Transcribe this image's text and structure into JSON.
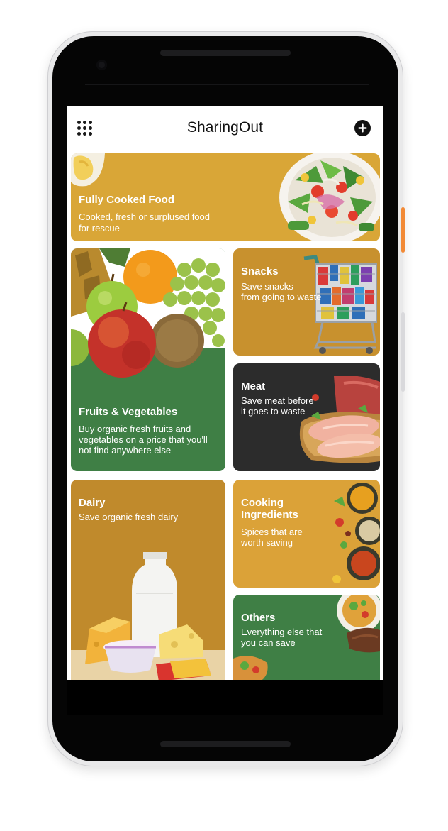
{
  "app": {
    "title": "SharingOut",
    "menu_icon": "grid-menu-icon",
    "add_icon": "plus-circle-icon"
  },
  "colors": {
    "mustard": "#d9a637",
    "dark_mustard": "#c8912e",
    "green": "#3f7f45",
    "charcoal": "#2c2c2c",
    "phone_accent": "#f28a36"
  },
  "categories": {
    "cooked": {
      "title": "Fully Cooked Food",
      "subtitle_line1": "Cooked, fresh or surplused food",
      "subtitle_line2": "for rescue",
      "image": "salad-bowl-image"
    },
    "fruits": {
      "title": "Fruits & Vegetables",
      "subtitle_line1": "Buy organic fresh fruits and",
      "subtitle_line2": "vegetables on a price that you'll",
      "subtitle_line3": "not find anywhere else",
      "image": "fruit-assortment-image"
    },
    "snacks": {
      "title": "Snacks",
      "subtitle_line1": "Save snacks",
      "subtitle_line2": "from going to waste",
      "image": "shopping-cart-image"
    },
    "meat": {
      "title": "Meat",
      "subtitle_line1": "Save meat before",
      "subtitle_line2": "it goes to waste",
      "image": "raw-meat-board-image"
    },
    "dairy": {
      "title": "Dairy",
      "subtitle_line1": "Save organic fresh dairy",
      "image": "milk-cheese-image"
    },
    "cooking": {
      "title_line1": "Cooking",
      "title_line2": "Ingredients",
      "subtitle_line1": "Spices that are",
      "subtitle_line2": "worth saving",
      "image": "spice-bowls-image"
    },
    "others": {
      "title": "Others",
      "subtitle_line1": "Everything else that",
      "subtitle_line2": "you can save",
      "image": "mixed-dishes-image"
    }
  }
}
